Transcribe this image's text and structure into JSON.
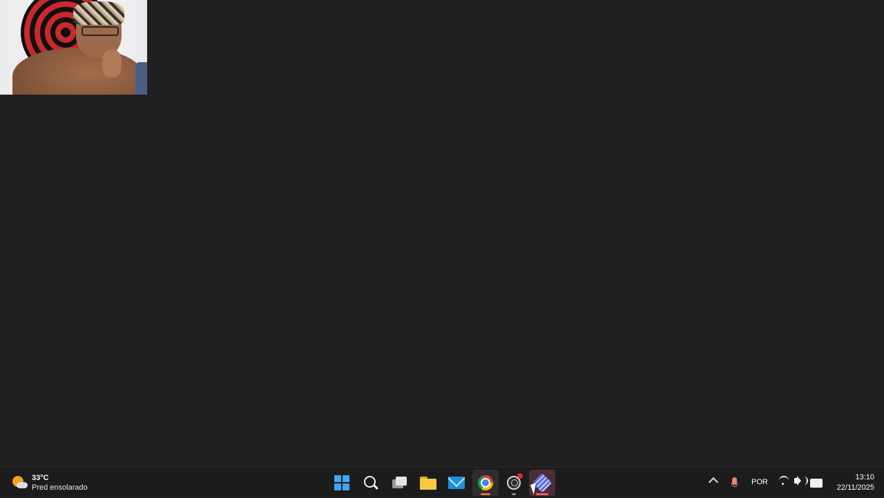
{
  "weather": {
    "temperature": "33°C",
    "condition": "Pred ensolarado"
  },
  "taskbar": {
    "apps": [
      {
        "name": "Start",
        "icon": "windows-logo"
      },
      {
        "name": "Search",
        "icon": "search-icon"
      },
      {
        "name": "Task View",
        "icon": "task-view-icon"
      },
      {
        "name": "File Explorer",
        "icon": "folder-icon"
      },
      {
        "name": "Mail",
        "icon": "mail-icon"
      },
      {
        "name": "Google Chrome",
        "icon": "chrome-icon",
        "running": true
      },
      {
        "name": "OBS Studio",
        "icon": "obs-icon",
        "recording": true
      },
      {
        "name": "Active app",
        "icon": "tool-icon",
        "active": true
      }
    ],
    "indicator_colors": {
      "chrome": "#e5683f",
      "obs": "#8a8a8a",
      "active": "#f05a6e"
    }
  },
  "tray": {
    "language": "POR",
    "time": "13:10",
    "date": "22/11/2025"
  },
  "colors": {
    "desktop_bg": "#202020",
    "taskbar_bg": "#1c1c1c",
    "accent": "#3fa7f0"
  }
}
